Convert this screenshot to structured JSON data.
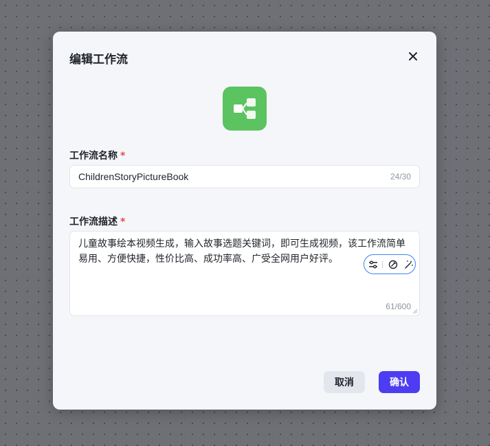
{
  "dialog": {
    "title": "编辑工作流",
    "close_icon": "close-icon",
    "app_icon": "workflow-icon",
    "icon_color": "#5bc35f"
  },
  "name_field": {
    "label": "工作流名称",
    "required_mark": "*",
    "value": "ChildrenStoryPictureBook",
    "counter": "24/30"
  },
  "description_field": {
    "label": "工作流描述",
    "required_mark": "*",
    "value": "儿童故事绘本视频生成，输入故事选题关键词，即可生成视频，该工作流简单易用、方便快捷，性价比高、成功率高、广受全网用户好评。",
    "counter": "61/600",
    "ai_tools": [
      "adjust-icon",
      "no-edit-icon",
      "magic-wand-icon"
    ]
  },
  "footer": {
    "cancel_label": "取消",
    "confirm_label": "确认",
    "confirm_color": "#4d3cf2"
  }
}
